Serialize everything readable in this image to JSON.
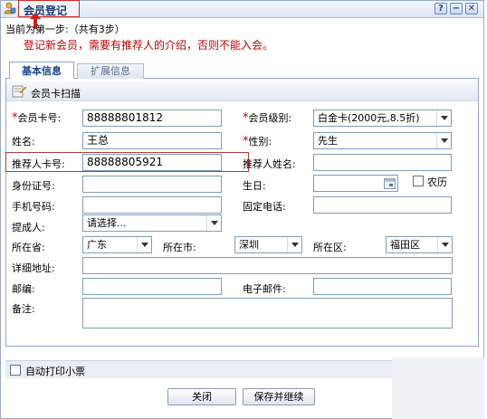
{
  "window": {
    "title": "会员登记",
    "controls": {
      "help": "?",
      "minimize": "−",
      "close": "✕"
    }
  },
  "header": {
    "step_text": "当前为第一步:（共有3步）",
    "intro_text": "登记新会员，需要有推荐人的介绍，否则不能入会。"
  },
  "tabs": [
    {
      "label": "基本信息",
      "active": true
    },
    {
      "label": "扩展信息",
      "active": false
    }
  ],
  "toolbar": {
    "scan_label": "会员卡扫描"
  },
  "form": {
    "card_no": {
      "label": "会员卡号:",
      "value": "88888801812",
      "required_mark": "*"
    },
    "level": {
      "label": "会员级别:",
      "value": "白金卡(2000元,8.5折)",
      "required_mark": "*"
    },
    "name": {
      "label": "姓名:",
      "value": "王总"
    },
    "gender": {
      "label": "性别:",
      "value": "先生",
      "required_mark": "*"
    },
    "referrer_card": {
      "label": "推荐人卡号:",
      "value": "88888805921"
    },
    "referrer_name": {
      "label": "推荐人姓名:",
      "value": ""
    },
    "id_no": {
      "label": "身份证号:",
      "value": ""
    },
    "birthday": {
      "label": "生日:",
      "value": ""
    },
    "lunar": {
      "label": "农历",
      "checked": false
    },
    "mobile": {
      "label": "手机号码:",
      "value": ""
    },
    "phone": {
      "label": "固定电话:",
      "value": ""
    },
    "proposer": {
      "label": "提成人:",
      "value": "请选择..."
    },
    "province": {
      "label": "所在省:",
      "value": "广东"
    },
    "city": {
      "label": "所在市:",
      "value": "深圳"
    },
    "district": {
      "label": "所在区:",
      "value": "福田区"
    },
    "address": {
      "label": "详细地址:",
      "value": ""
    },
    "postcode": {
      "label": "邮编:",
      "value": ""
    },
    "email": {
      "label": "电子邮件:",
      "value": ""
    },
    "remark": {
      "label": "备注:",
      "value": ""
    }
  },
  "footer": {
    "auto_print": {
      "label": "自动打印小票",
      "checked": false
    },
    "close_label": "关闭",
    "save_continue_label": "保存并继续"
  },
  "colors": {
    "required": "#c00000",
    "intro": "#c00000",
    "highlight_border": "#b23a3a",
    "title_text": "#1e3a78"
  }
}
